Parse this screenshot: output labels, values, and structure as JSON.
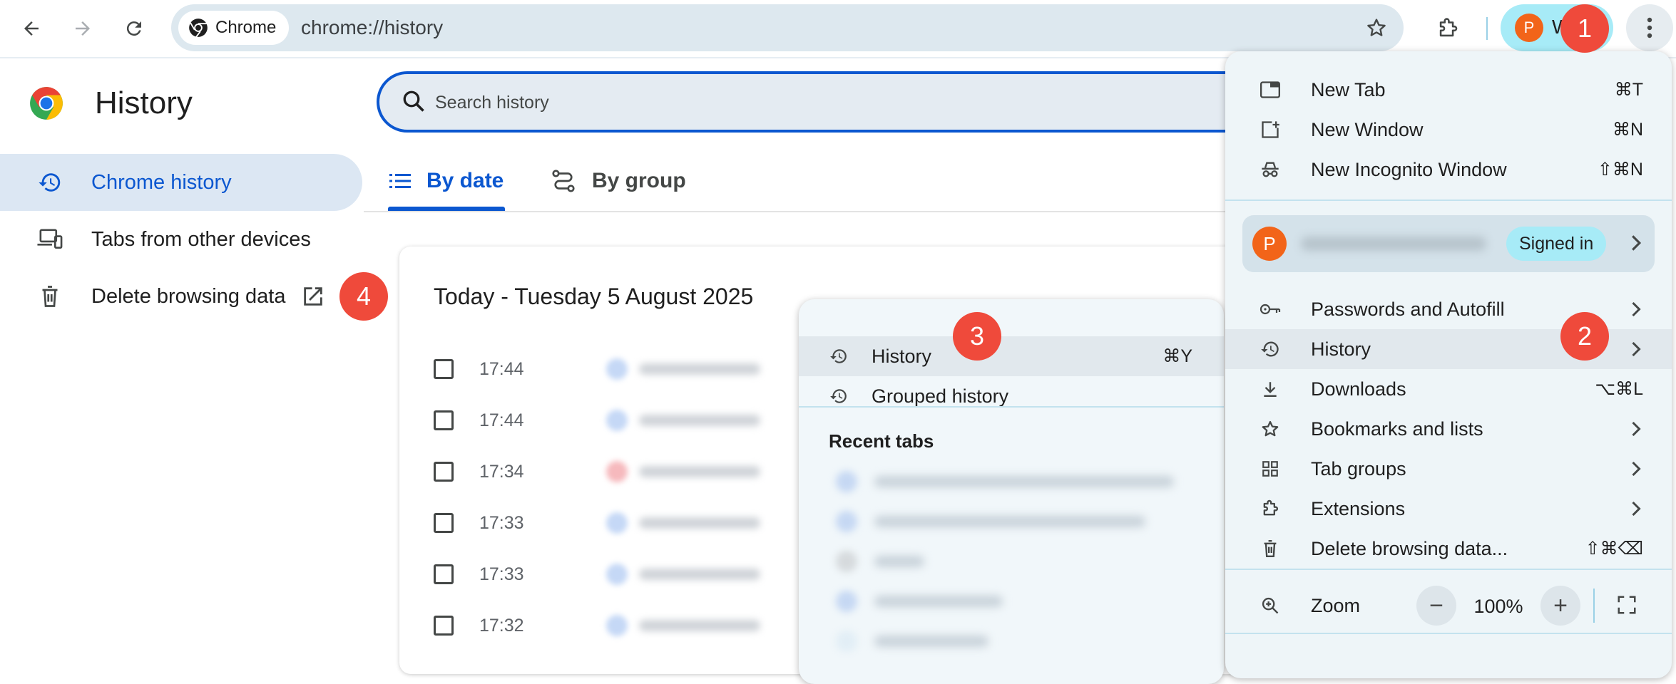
{
  "toolbar": {
    "chip_label": "Chrome",
    "url": "chrome://history",
    "profile_initial": "P",
    "profile_label_partial": "W"
  },
  "sidebar": {
    "title": "History",
    "items": [
      {
        "label": "Chrome history",
        "icon": "history-icon",
        "selected": true
      },
      {
        "label": "Tabs from other devices",
        "icon": "devices-icon"
      },
      {
        "label": "Delete browsing data",
        "icon": "trash-icon",
        "trailing_icon": "open-external-icon"
      }
    ]
  },
  "search": {
    "placeholder": "Search history"
  },
  "tabs": [
    {
      "label": "By date",
      "icon": "list-icon",
      "selected": true
    },
    {
      "label": "By group",
      "icon": "journeys-icon"
    }
  ],
  "history_card": {
    "heading": "Today - Tuesday 5 August 2025",
    "rows": [
      {
        "time": "17:44",
        "favicon_color": "#c5d8f6"
      },
      {
        "time": "17:44",
        "favicon_color": "#c5d8f6"
      },
      {
        "time": "17:34",
        "favicon_color": "#f6b9bd"
      },
      {
        "time": "17:33",
        "favicon_color": "#c5d8f6"
      },
      {
        "time": "17:33",
        "favicon_color": "#c5d8f6"
      },
      {
        "time": "17:32",
        "favicon_color": "#c5d8f6"
      }
    ]
  },
  "history_submenu": {
    "items": [
      {
        "label": "History",
        "shortcut": "⌘Y"
      },
      {
        "label": "Grouped history"
      }
    ],
    "recent_tabs_heading": "Recent tabs"
  },
  "chrome_menu": {
    "items": [
      {
        "label": "New Tab",
        "shortcut": "⌘T"
      },
      {
        "label": "New Window",
        "shortcut": "⌘N"
      },
      {
        "label": "New Incognito Window",
        "shortcut": "⇧⌘N"
      }
    ],
    "profile": {
      "initial": "P",
      "status": "Signed in"
    },
    "items2": [
      {
        "label": "Passwords and Autofill"
      },
      {
        "label": "History"
      },
      {
        "label": "Downloads",
        "shortcut": "⌥⌘L"
      },
      {
        "label": "Bookmarks and lists"
      },
      {
        "label": "Tab groups"
      },
      {
        "label": "Extensions"
      },
      {
        "label": "Delete browsing data...",
        "shortcut": "⇧⌘⌫"
      }
    ],
    "zoom": {
      "label": "Zoom",
      "minus": "−",
      "value": "100%",
      "plus": "+"
    }
  },
  "badges": [
    "1",
    "2",
    "3",
    "4"
  ],
  "colors": {
    "accent": "#0b57d0",
    "badge": "#ef4a3b",
    "pill": "#a7ebf7"
  }
}
